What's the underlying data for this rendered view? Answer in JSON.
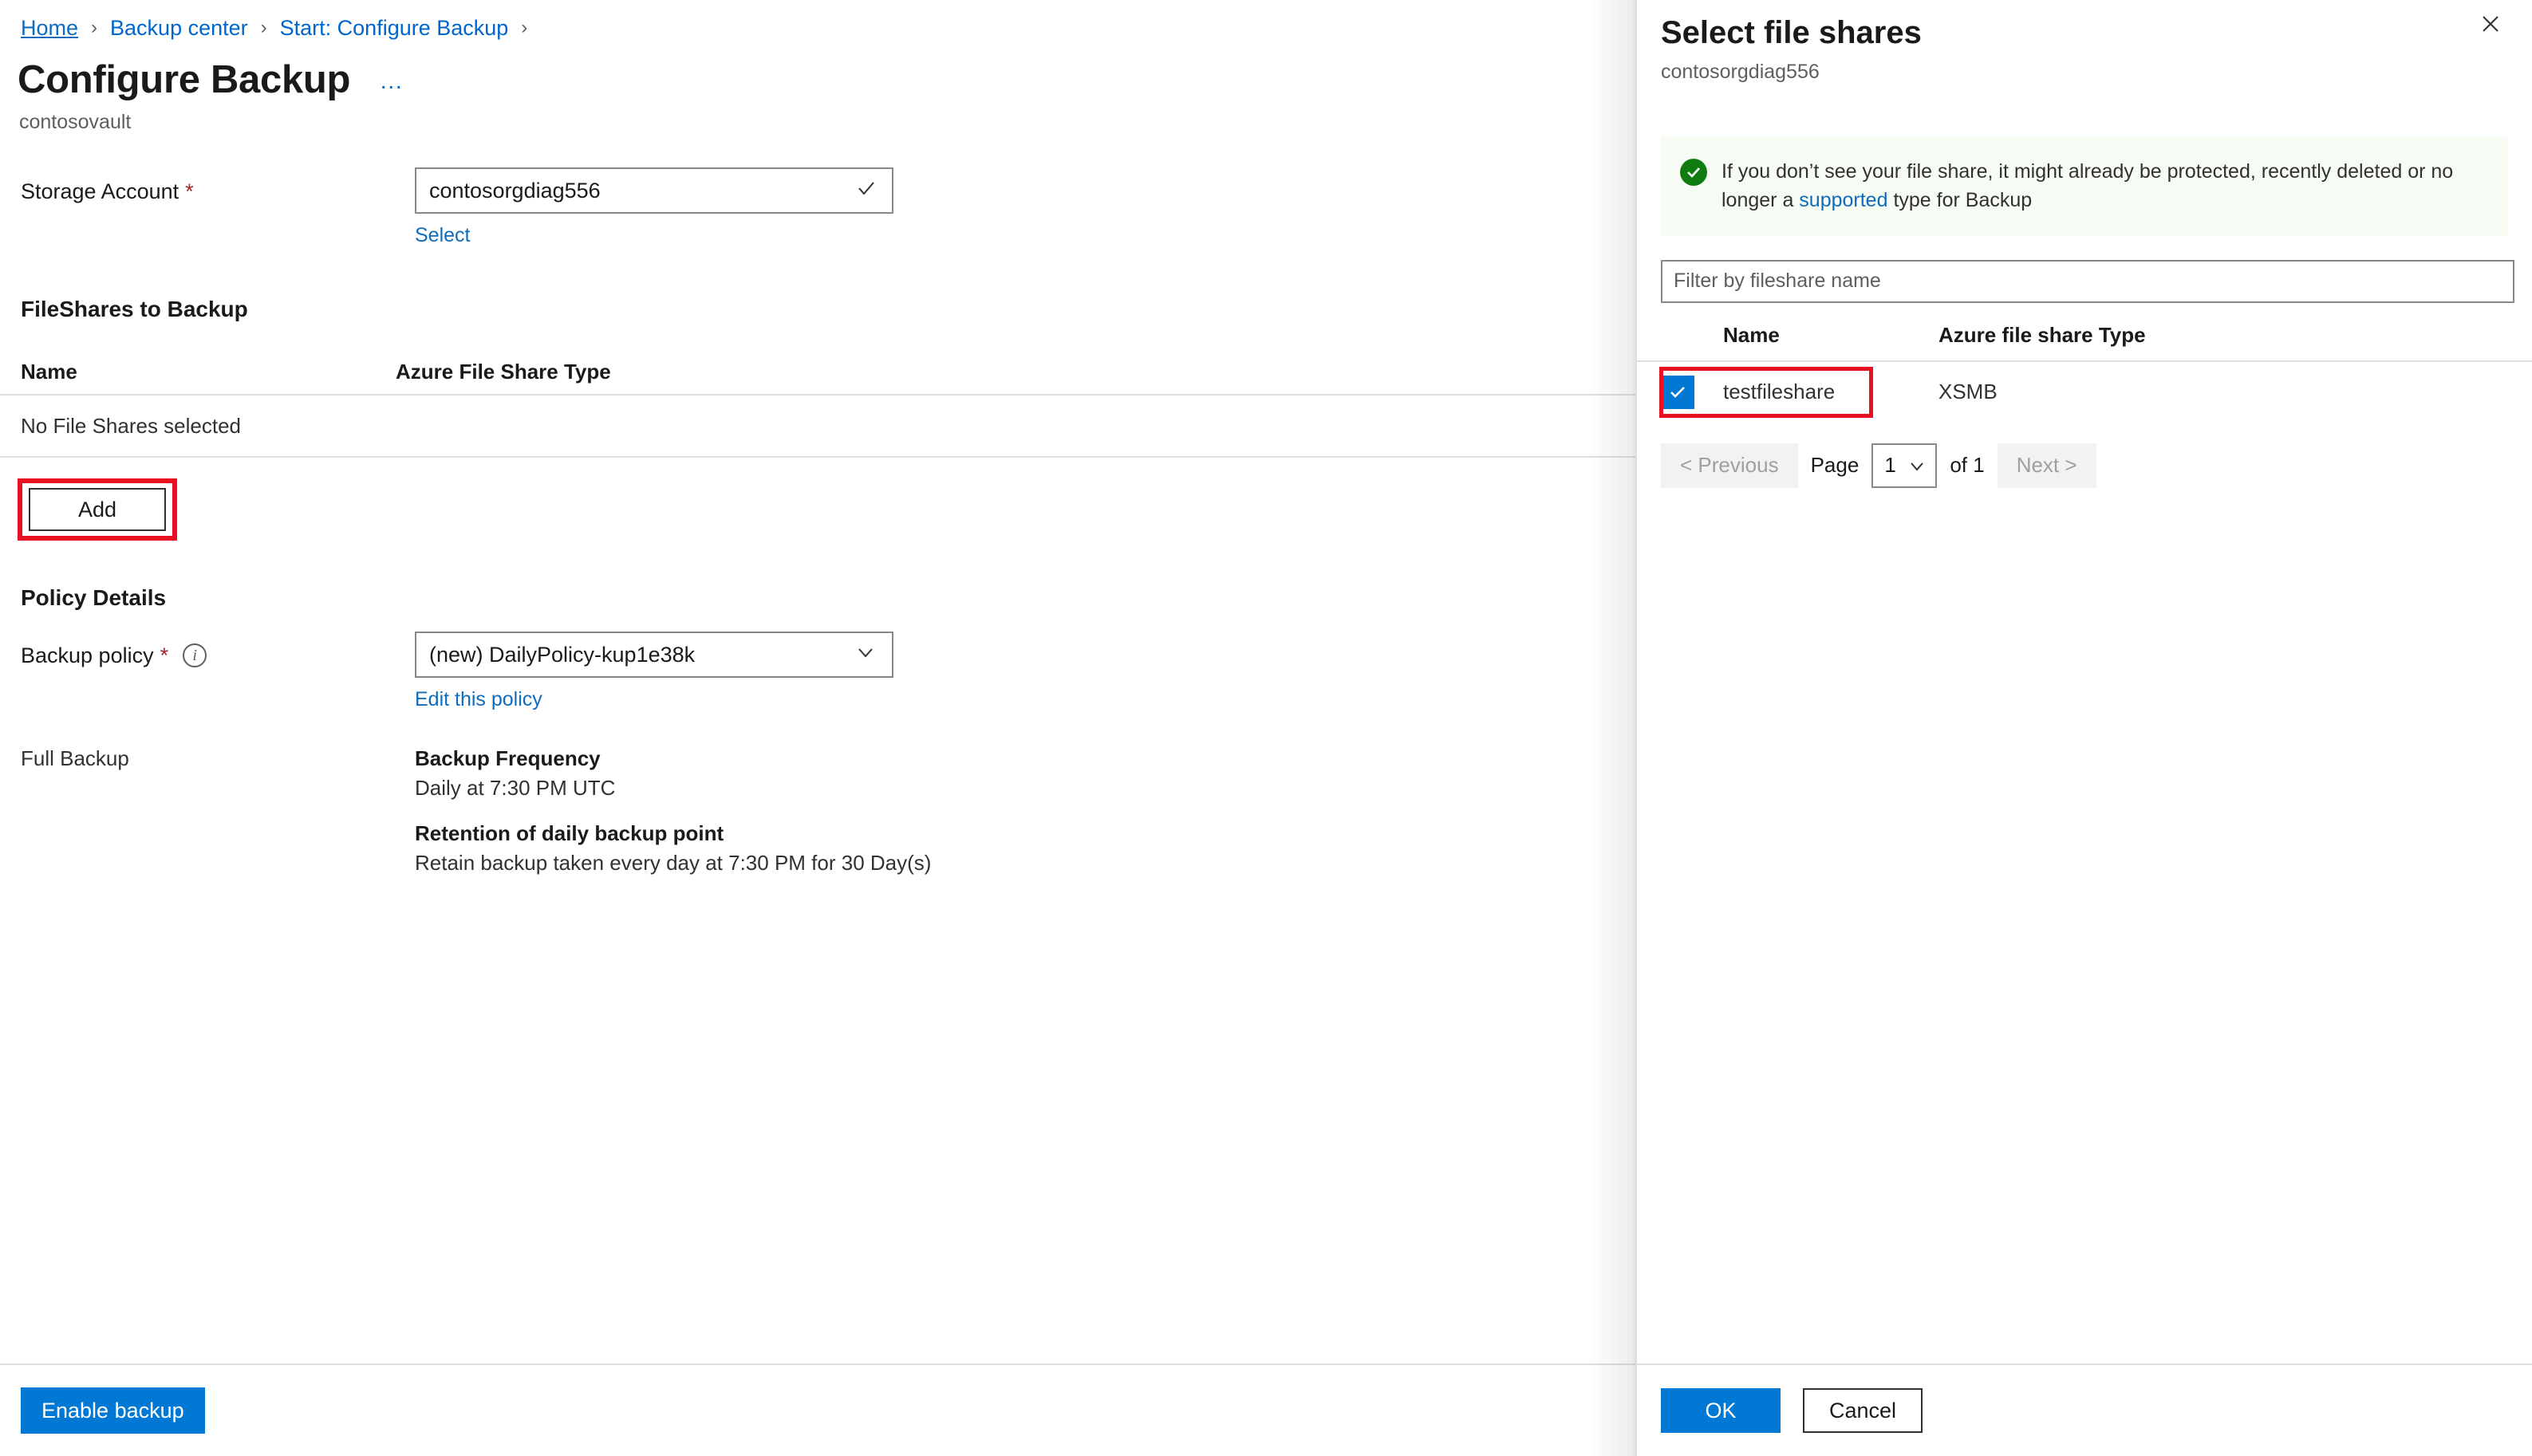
{
  "breadcrumb": {
    "items": [
      {
        "label": "Home"
      },
      {
        "label": "Backup center"
      },
      {
        "label": "Start: Configure Backup"
      }
    ],
    "separator": "›"
  },
  "left_blade": {
    "title": "Configure Backup",
    "subtitle": "contosovault",
    "ellipsis": "…",
    "storage_account": {
      "label": "Storage Account",
      "required_marker": "*",
      "value": "contosorgdiag556",
      "indicator_icon": "check-icon",
      "select_link": "Select"
    },
    "fileshares_section": {
      "heading": "FileShares to Backup",
      "columns": [
        "Name",
        "Azure File Share Type"
      ],
      "rows": [
        {
          "name": "No File Shares selected",
          "type": ""
        }
      ],
      "add_button": "Add"
    },
    "policy_section": {
      "heading": "Policy Details",
      "backup_policy_label": "Backup policy",
      "required_marker": "*",
      "info_icon": "info-icon",
      "backup_policy_value": "(new) DailyPolicy-kup1e38k",
      "edit_link": "Edit this policy",
      "full_backup_label": "Full Backup",
      "frequency_heading": "Backup Frequency",
      "frequency_value": "Daily at 7:30 PM UTC",
      "retention_heading": "Retention of daily backup point",
      "retention_value": "Retain backup taken every day at 7:30 PM for 30 Day(s)"
    },
    "footer": {
      "enable_backup": "Enable backup"
    }
  },
  "right_panel": {
    "title": "Select file shares",
    "subtitle": "contosorgdiag556",
    "close_icon": "close-icon",
    "banner": {
      "icon": "success-check-icon",
      "text_before": "If you don’t see your file share, it might already be protected, recently deleted or no longer a ",
      "link": "supported",
      "text_after": " type for Backup"
    },
    "filter": {
      "placeholder": "Filter by fileshare name",
      "value": ""
    },
    "table": {
      "columns": [
        "Name",
        "Azure file share Type"
      ],
      "rows": [
        {
          "name": "testfileshare",
          "type": "XSMB",
          "checked": true
        }
      ]
    },
    "pagination": {
      "previous": "< Previous",
      "page_label": "Page",
      "current_page": "1",
      "of_label": "of 1",
      "next": "Next >"
    },
    "footer": {
      "ok": "OK",
      "cancel": "Cancel"
    }
  },
  "colors": {
    "accent": "#0078d4",
    "link": "#0f6cbd",
    "highlight": "#e81123",
    "required": "#a4262c",
    "success": "#107c10",
    "banner_bg": "#f6fbf4"
  }
}
